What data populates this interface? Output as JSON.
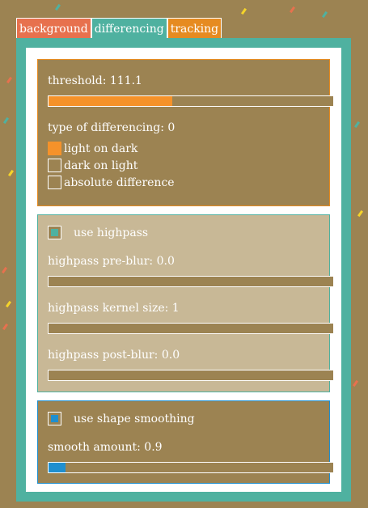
{
  "tabs": [
    {
      "label": "background"
    },
    {
      "label": "differencing"
    },
    {
      "label": "tracking"
    }
  ],
  "differencing_panel": {
    "threshold_label": "threshold: 111.1",
    "threshold_level": 0.44,
    "type_label": "type of differencing: 0",
    "options": [
      {
        "label": "light on dark",
        "selected": true
      },
      {
        "label": "dark on light",
        "selected": false
      },
      {
        "label": "absolute difference",
        "selected": false
      }
    ]
  },
  "highpass_panel": {
    "toggle_label": "use highpass",
    "toggle_checked": true,
    "pre_blur_label": "highpass pre-blur: 0.0",
    "pre_blur_level": 0,
    "kernel_label": "highpass kernel size: 1",
    "kernel_level": 0,
    "post_blur_label": "highpass post-blur: 0.0",
    "post_blur_level": 0
  },
  "smoothing_panel": {
    "toggle_label": "use shape smoothing",
    "toggle_checked": true,
    "amount_label": "smooth amount: 0.9",
    "amount_level": 0.06
  },
  "colors": {
    "background": "#9c8352",
    "tab_background": "#e7714e",
    "tab_differencing": "#4fb1a0",
    "tab_tracking": "#e68b21",
    "accent_orange": "#f5922a",
    "accent_blue": "#1f8fcf",
    "highpass_panel": "#c8b896"
  }
}
